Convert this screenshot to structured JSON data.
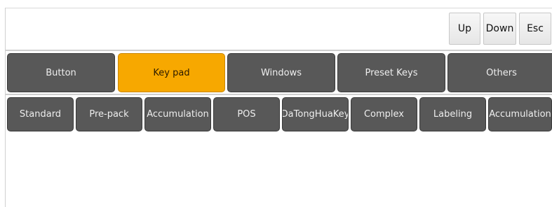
{
  "header": {
    "up_label": "Up",
    "down_label": "Down",
    "esc_label": "Esc"
  },
  "categories": [
    {
      "label": "Button",
      "active": false
    },
    {
      "label": "Key pad",
      "active": true
    },
    {
      "label": "Windows",
      "active": false
    },
    {
      "label": "Preset Keys",
      "active": false
    },
    {
      "label": "Others",
      "active": false
    }
  ],
  "subtabs": [
    {
      "label": "Standard"
    },
    {
      "label": "Pre-pack"
    },
    {
      "label": "Accumulation"
    },
    {
      "label": "POS"
    },
    {
      "label": "DaTongHuaKey"
    },
    {
      "label": "Complex"
    },
    {
      "label": "Labeling"
    },
    {
      "label": "Accumulation"
    }
  ],
  "colors": {
    "active_tab": "#f7a800",
    "tab_bg": "#585858"
  }
}
